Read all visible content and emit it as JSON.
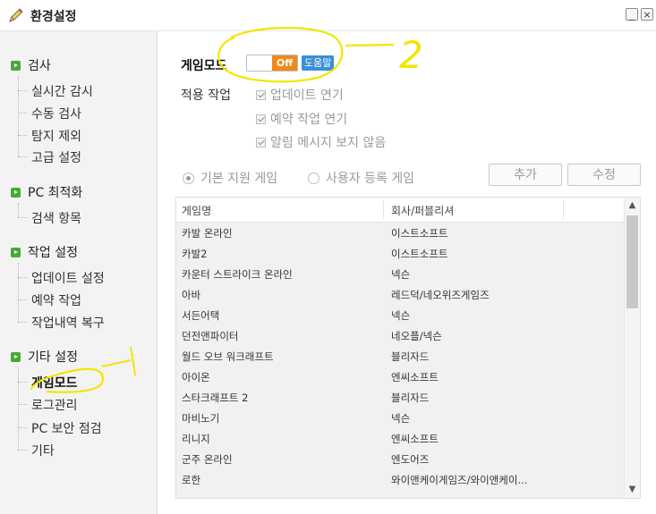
{
  "window": {
    "title": "환경설정",
    "minimize_glyph": "_",
    "close_glyph": "×"
  },
  "sidebar": {
    "groups": [
      {
        "label": "검사",
        "items": [
          "실시간 감시",
          "수동 검사",
          "탐지 제외",
          "고급 설정"
        ]
      },
      {
        "label": "PC 최적화",
        "items": [
          "검색 항목"
        ]
      },
      {
        "label": "작업 설정",
        "items": [
          "업데이트 설정",
          "예약 작업",
          "작업내역 복구"
        ]
      },
      {
        "label": "기타 설정",
        "items": [
          "게임모드",
          "로그관리",
          "PC 보안 점검",
          "기타"
        ]
      }
    ],
    "active_item": "게임모드"
  },
  "game_mode": {
    "label": "게임모드",
    "toggle_state": "Off",
    "help_label": "도움말",
    "apply_label": "적용 작업",
    "options": [
      "업데이트 연기",
      "예약 작업 연기",
      "알림 메시지 보지 않음"
    ],
    "options_checked": [
      true,
      true,
      true
    ],
    "radio_basic": "기본 지원 게임",
    "radio_user": "사용자 등록 게임",
    "radio_selected": "기본 지원 게임",
    "add_button": "추가",
    "edit_button": "수정"
  },
  "games_table": {
    "columns": [
      "게임명",
      "회사/퍼블리셔"
    ],
    "rows": [
      [
        "카발 온라인",
        "이스트소프트"
      ],
      [
        "카발2",
        "이스트소프트"
      ],
      [
        "카운터 스트라이크 온라인",
        "넥슨"
      ],
      [
        "아바",
        "레드덕/네오위즈게임즈"
      ],
      [
        "서든어택",
        "넥슨"
      ],
      [
        "던전앤파이터",
        "네오플/넥슨"
      ],
      [
        "월드 오브 워크래프트",
        "블리자드"
      ],
      [
        "아이온",
        "엔씨소프트"
      ],
      [
        "스타크래프트 2",
        "블리자드"
      ],
      [
        "마비노기",
        "넥슨"
      ],
      [
        "리니지",
        "엔씨소프트"
      ],
      [
        "군주 온라인",
        "엔도어즈"
      ],
      [
        "로한",
        "와이앤케이게임즈/와이앤케이..."
      ]
    ]
  },
  "annotations": {
    "number_label": "2"
  },
  "colors": {
    "accent_green": "#4aa83a",
    "toggle_orange": "#f08a1c",
    "help_blue": "#3a8fd6",
    "highlight_yellow": "#f2e600"
  }
}
